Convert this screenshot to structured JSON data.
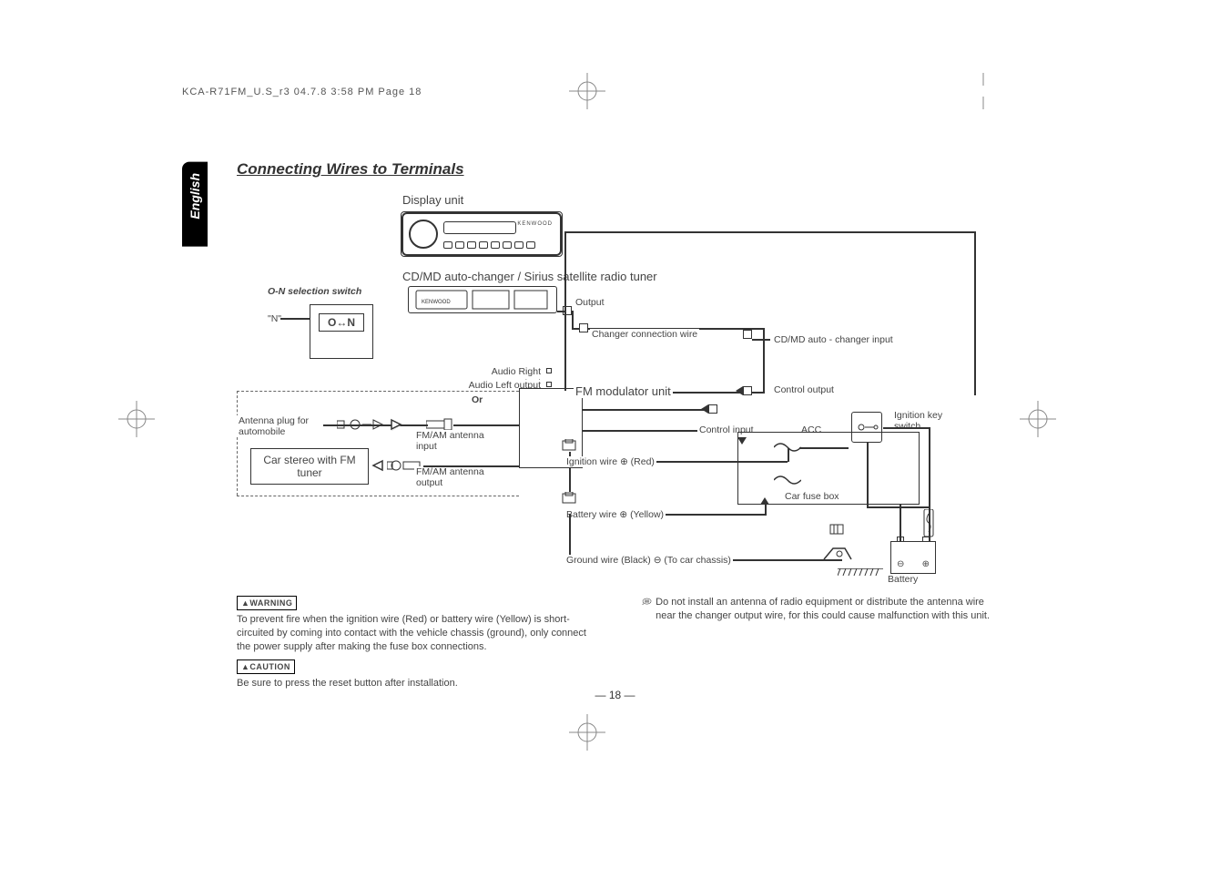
{
  "header": "KCA-R71FM_U.S_r3  04.7.8  3:58 PM  Page 18",
  "language_tab": "English",
  "section_title": "Connecting Wires to Terminals",
  "labels": {
    "display_unit": "Display unit",
    "changer_title": "CD/MD auto-changer / Sirius satellite radio tuner",
    "on_switch": "O-N selection switch",
    "n_mark": "\"N\"",
    "on_text": "O↔N",
    "output": "Output",
    "changer_wire": "Changer connection wire",
    "changer_input": "CD/MD auto - changer input",
    "audio_r": "Audio Right output",
    "audio_l": "Audio Left output",
    "fm_mod": "FM modulator unit",
    "or": "Or",
    "control_out": "Control output",
    "antenna_plug": "Antenna plug for automobile",
    "fmam_in": "FM/AM antenna input",
    "control_in": "Control input",
    "acc": "ACC",
    "ignition_key": "Ignition key switch",
    "car_stereo": "Car stereo with FM tuner",
    "ignition_wire": "Ignition wire ⊕ (Red)",
    "fmam_out": "FM/AM antenna output",
    "fuse": "Car fuse box",
    "battery_wire": "Battery wire ⊕ (Yellow)",
    "ground_wire": "Ground wire (Black) ⊖ (To car chassis)",
    "battery": "Battery",
    "brand": "KENWOOD"
  },
  "notes": {
    "warning_badge": "▲WARNING",
    "warning_text": "To prevent fire when the ignition wire (Red) or battery wire (Yellow) is short-circuited by coming into contact with the vehicle chassis (ground), only connect the power supply after making the fuse box connections.",
    "caution_badge": "▲CAUTION",
    "caution_text": "Be sure to press the reset button after installation.",
    "antenna_note": "Do not install an antenna of radio equipment or distribute the antenna wire near the changer output wire, for this could cause malfunction with this unit."
  },
  "page_number": "— 18 —",
  "battery_marks": {
    "minus": "⊖",
    "plus": "⊕"
  }
}
